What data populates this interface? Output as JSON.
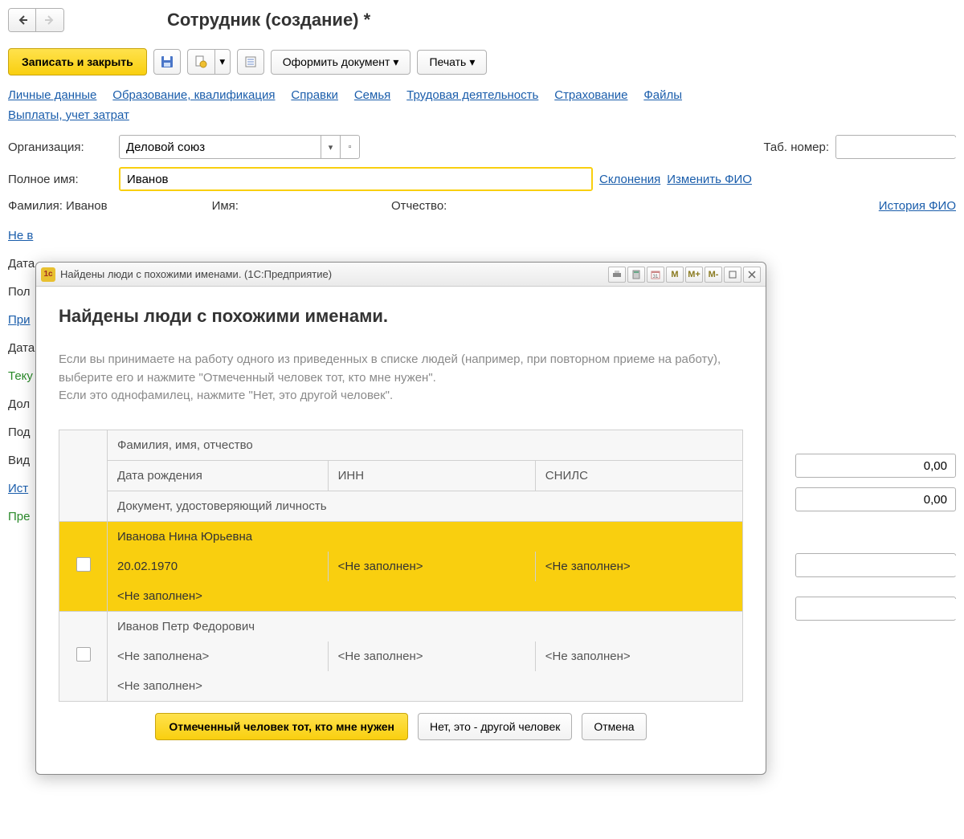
{
  "page_title": "Сотрудник (создание) *",
  "toolbar": {
    "save_close": "Записать и закрыть",
    "doc_button": "Оформить документ",
    "print_button": "Печать"
  },
  "links": {
    "personal": "Личные данные",
    "education": "Образование, квалификация",
    "refs": "Справки",
    "family": "Семья",
    "work": "Трудовая деятельность",
    "insurance": "Страхование",
    "files": "Файлы",
    "payments": "Выплаты, учет затрат"
  },
  "form": {
    "org_label": "Организация:",
    "org_value": "Деловой союз",
    "tab_label": "Таб. номер:",
    "fullname_label": "Полное имя:",
    "fullname_value": "Иванов",
    "declension": "Склонения",
    "change_fio": "Изменить ФИО",
    "surname_label": "Фамилия:",
    "surname_value": "Иванов",
    "name_label": "Имя:",
    "patronymic_label": "Отчество:",
    "history_fio": "История ФИО",
    "not_in": "Не в",
    "date": "Дата",
    "pol": "Пол",
    "pri": "При",
    "tek": "Теку",
    "dol": "Дол",
    "pod": "Под",
    "vid": "Вид",
    "ist": "Ист",
    "pre": "Пре",
    "zero": "0,00"
  },
  "dialog": {
    "window_title": "Найдены люди с похожими именами.  (1С:Предприятие)",
    "heading": "Найдены люди с похожими именами.",
    "text1": "Если вы принимаете на работу одного из приведенных в списке людей (например, при повторном приеме на работу), выберите его и нажмите \"Отмеченный человек тот, кто мне нужен\".",
    "text2": "Если это однофамилец, нажмите \"Нет, это другой человек\".",
    "headers": {
      "fio": "Фамилия, имя, отчество",
      "dob": "Дата рождения",
      "inn": "ИНН",
      "snils": "СНИЛС",
      "doc": "Документ, удостоверяющий личность"
    },
    "rows": [
      {
        "fio": "Иванова Нина Юрьевна",
        "dob": "20.02.1970",
        "inn": "<Не заполнен>",
        "snils": "<Не заполнен>",
        "doc": "<Не заполнен>",
        "selected": true
      },
      {
        "fio": "Иванов Петр Федорович",
        "dob": "<Не заполнена>",
        "inn": "<Не заполнен>",
        "snils": "<Не заполнен>",
        "doc": "<Не заполнен>",
        "selected": false
      }
    ],
    "confirm_btn": "Отмеченный человек тот, кто мне нужен",
    "other_btn": "Нет, это - другой человек",
    "cancel_btn": "Отмена",
    "tool_m": "M",
    "tool_mplus": "M+",
    "tool_mminus": "M-"
  }
}
